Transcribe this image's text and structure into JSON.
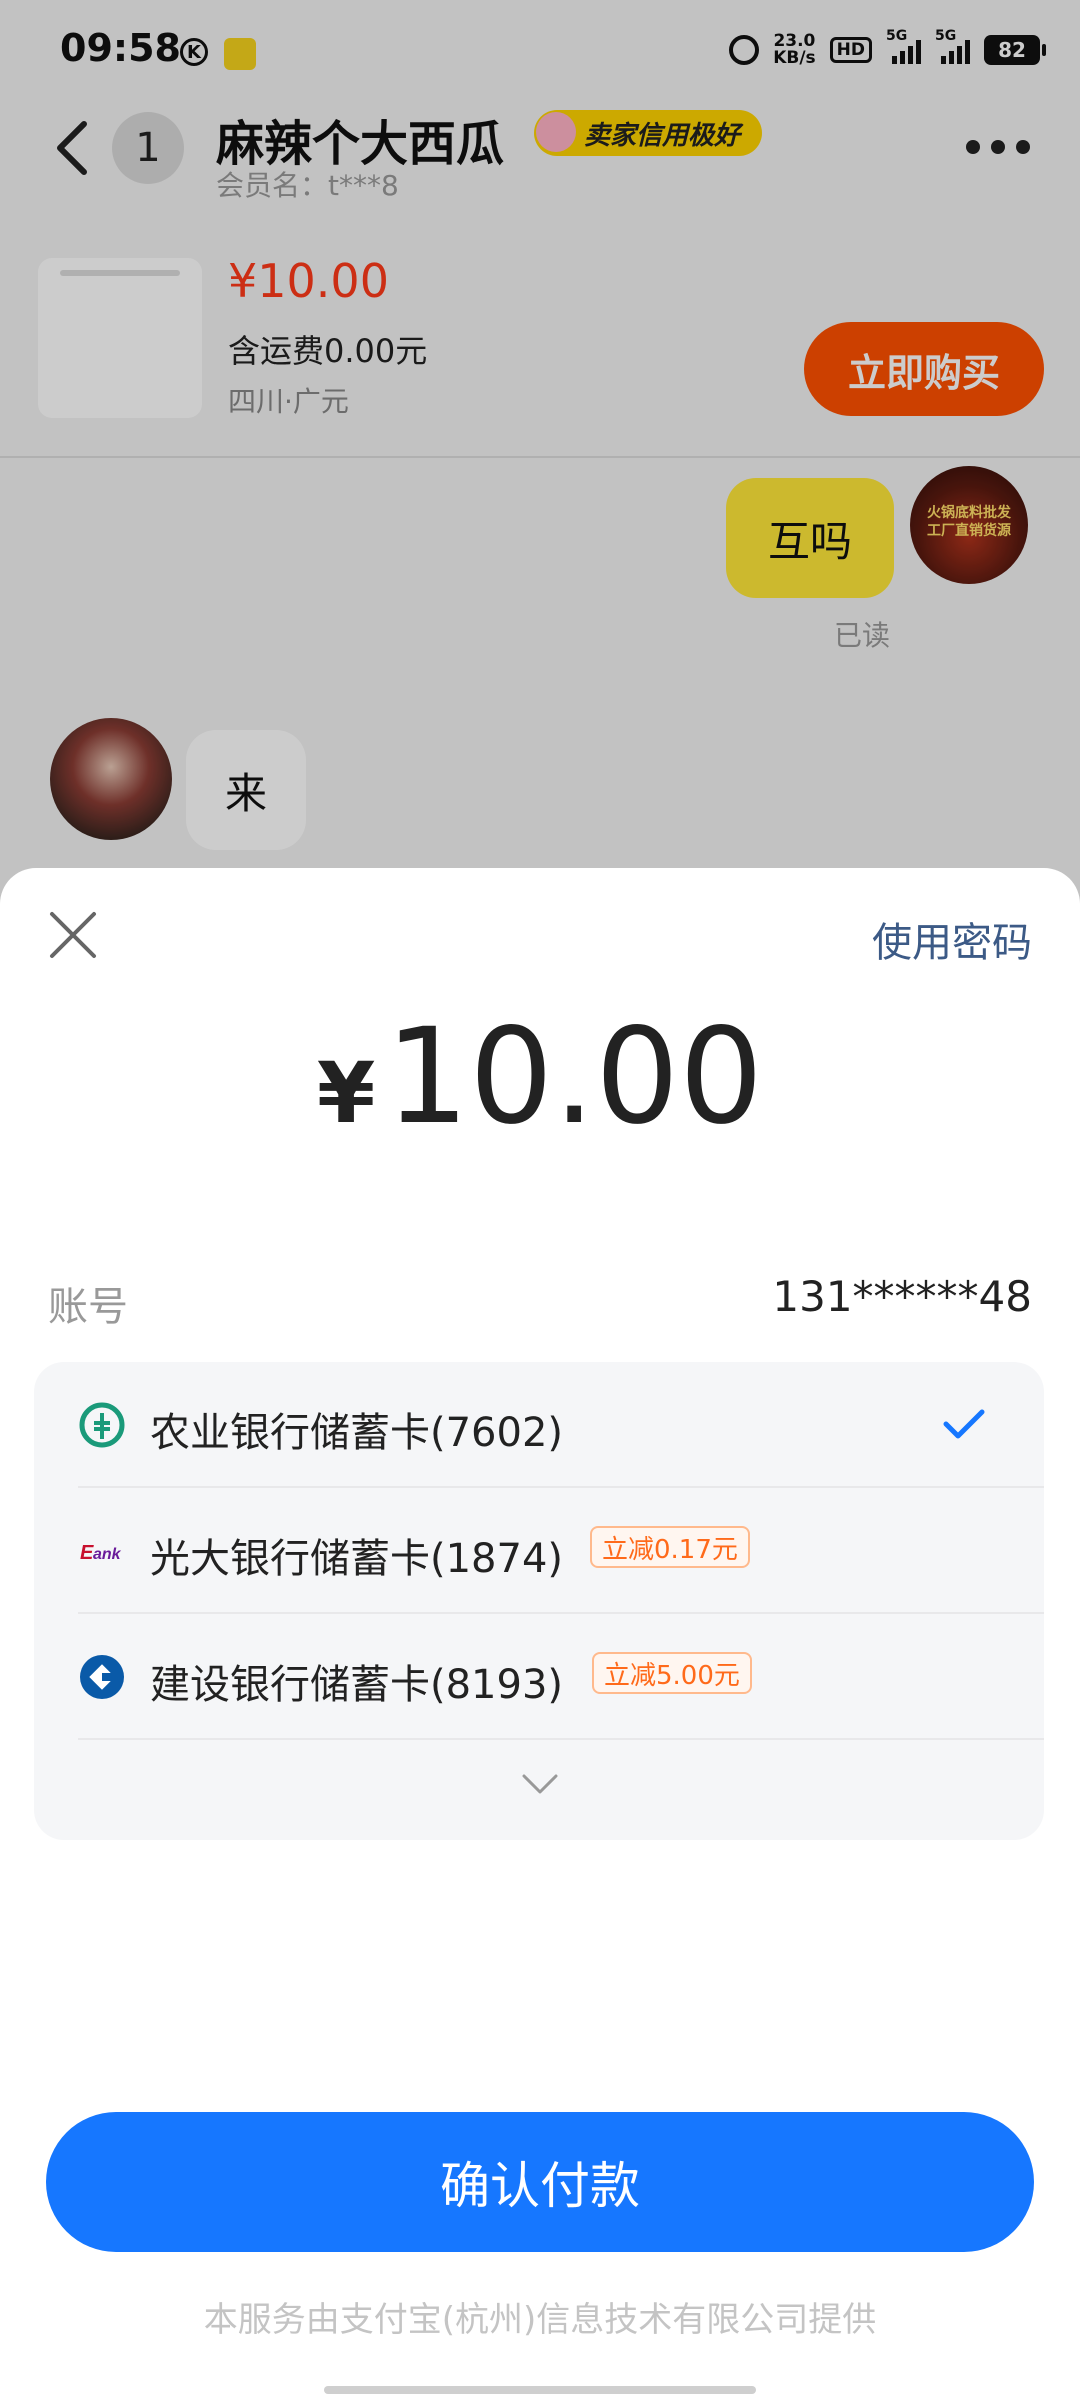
{
  "status_bar": {
    "time": "09:58",
    "k_icon": "K",
    "net_speed_value": "23.0",
    "net_speed_unit": "KB/s",
    "hd_label": "HD",
    "signal1_label": "5G",
    "signal2_label": "5G",
    "battery": "82"
  },
  "chat_header": {
    "unread_count": "1",
    "shop_name": "麻辣个大西瓜",
    "credit_badge": "卖家信用极好",
    "member_name": "会员名：t***8"
  },
  "product": {
    "price": "¥10.00",
    "shipping": "含运费0.00元",
    "location": "四川·广元",
    "buy_label": "立即购买"
  },
  "messages": {
    "outgoing_text": "互吗",
    "read_status": "已读",
    "outgoing_avatar_text": "火锅底料批发 工厂直销货源",
    "incoming_text": "来"
  },
  "payment": {
    "use_password": "使用密码",
    "currency": "¥",
    "amount": "10.00",
    "account_label": "账号",
    "account_value": "131******48",
    "cards": [
      {
        "label": "农业银行储蓄卡(7602)",
        "selected": true,
        "logo": "abc-bank-logo"
      },
      {
        "label": "光大银行储蓄卡(1874)",
        "discount": "立减0.17元",
        "logo": "ceb-bank-logo"
      },
      {
        "label": "建设银行储蓄卡(8193)",
        "discount": "立减5.00元",
        "logo": "ccb-bank-logo"
      }
    ],
    "confirm_label": "确认付款",
    "footer": "本服务由支付宝(杭州)信息技术有限公司提供"
  },
  "colors": {
    "primary_blue": "#1677ff",
    "buy_orange": "#ff5000",
    "price_red": "#ff3a1a",
    "credit_yellow": "#ffd400",
    "bubble_yellow": "#ffe83a",
    "discount_orange": "#ff6a1a"
  }
}
